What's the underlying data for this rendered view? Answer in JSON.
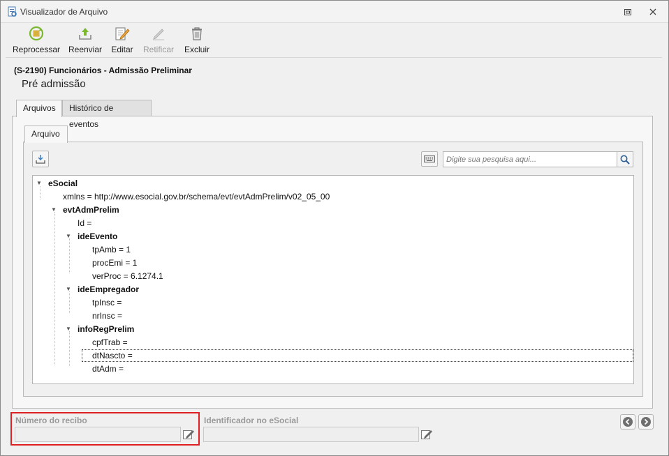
{
  "window": {
    "title": "Visualizador de Arquivo",
    "icon": "document-view-icon"
  },
  "toolbar": {
    "reprocess_label": "Reprocessar",
    "resend_label": "Reenviar",
    "edit_label": "Editar",
    "rectify_label": "Retificar",
    "delete_label": "Excluir"
  },
  "event": {
    "title": "(S-2190) Funcionários - Admissão Preliminar",
    "subtitle": "Pré admissão"
  },
  "tabs": {
    "files": "Arquivos",
    "history": "Histórico de eventos",
    "file": "Arquivo"
  },
  "search": {
    "placeholder": "Digite sua pesquisa aqui..."
  },
  "tree": {
    "nodes": [
      "eSocial",
      "xmlns = http://www.esocial.gov.br/schema/evt/evtAdmPrelim/v02_05_00",
      "evtAdmPrelim",
      "Id =",
      "ideEvento",
      "tpAmb = 1",
      "procEmi = 1",
      "verProc = 6.1274.1",
      "ideEmpregador",
      "tpInsc =",
      "nrInsc =",
      "infoRegPrelim",
      "cpfTrab =",
      "dtNascto =",
      "dtAdm ="
    ]
  },
  "fields": {
    "receipt_label": "Número do recibo",
    "receipt_value": "",
    "esocial_id_label": "Identificador no eSocial",
    "esocial_id_value": ""
  },
  "colors": {
    "highlight": "#e02020",
    "accent_green": "#7cb82f"
  }
}
